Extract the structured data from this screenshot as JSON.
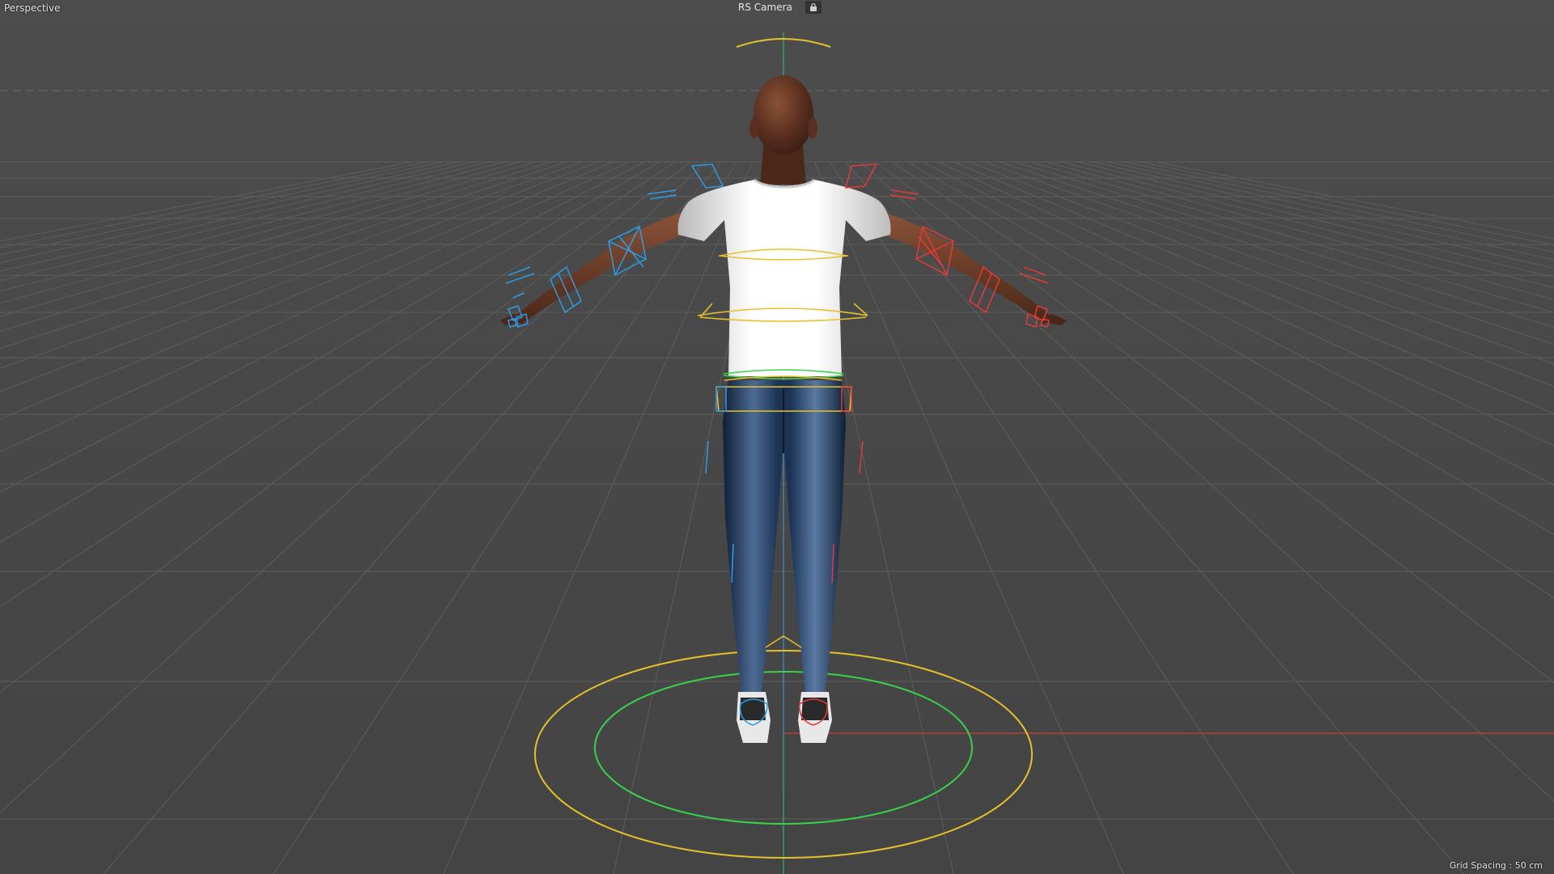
{
  "viewport": {
    "view_name": "Perspective",
    "camera_name": "RS Camera",
    "camera_lock_icon": "camera-lock-icon",
    "grid_spacing_label": "Grid Spacing : 50 cm"
  },
  "colors": {
    "background": "#4a4a4a",
    "grid": "#5d5d5d",
    "x_axis": "#d23c3c",
    "y_axis": "#2fc76b",
    "rig_left": "#2f9be6",
    "rig_right": "#e23a3a",
    "rig_center": "#e6c22a",
    "rig_root": "#39d14a",
    "skin": "#6b3a26",
    "shirt": "#f0f0f0",
    "jeans": "#1d3557",
    "shoes": "#eaeaea"
  },
  "scene": {
    "object": "character-model",
    "pose": "T-pose",
    "view_from": "back"
  }
}
